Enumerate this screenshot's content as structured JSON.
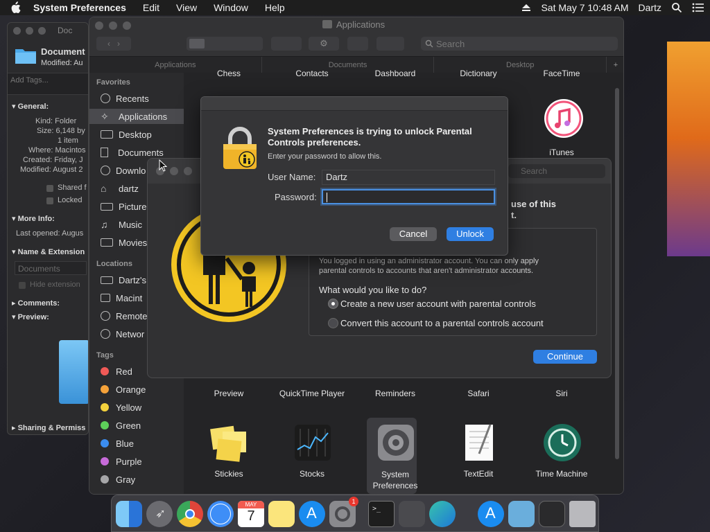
{
  "menubar": {
    "app_name": "System Preferences",
    "menus": [
      "Edit",
      "View",
      "Window",
      "Help"
    ],
    "datetime": "Sat May 7  10:48 AM",
    "user": "Dartz"
  },
  "info_window": {
    "title": "Doc",
    "name": "Document",
    "modified_short": "Modified: Au",
    "tags_placeholder": "Add Tags...",
    "general_header": "General:",
    "kind": "Kind: Folder",
    "size": "Size: 6,148 by",
    "items": "1 item",
    "where": "Where: Macintos",
    "created": "Created: Friday, J",
    "modified": "Modified: August 2",
    "shared": "Shared f",
    "locked": "Locked",
    "more_info": "More Info:",
    "last_opened": "Last opened: Augus",
    "name_ext": "Name & Extension",
    "name_value": "Documents",
    "hide_ext": "Hide extension",
    "comments": "Comments:",
    "preview": "Preview:",
    "sharing": "Sharing & Permiss"
  },
  "finder": {
    "title": "Applications",
    "search_placeholder": "Search",
    "tabs": [
      "Applications",
      "Documents",
      "Desktop"
    ],
    "sidebar": {
      "favorites_header": "Favorites",
      "favorites": [
        "Recents",
        "Applications",
        "Desktop",
        "Documents",
        "Downlo",
        "dartz",
        "Picture",
        "Music",
        "Movies"
      ],
      "locations_header": "Locations",
      "locations": [
        "Dartz's",
        "Macint",
        "Remote",
        "Networ"
      ],
      "tags_header": "Tags",
      "tags": [
        {
          "name": "Red",
          "color": "#f05a57"
        },
        {
          "name": "Orange",
          "color": "#f5a23a"
        },
        {
          "name": "Yellow",
          "color": "#f3d13d"
        },
        {
          "name": "Green",
          "color": "#5ed05a"
        },
        {
          "name": "Blue",
          "color": "#3b8df0"
        },
        {
          "name": "Purple",
          "color": "#c76bd9"
        },
        {
          "name": "Gray",
          "color": "#a6a6a8"
        }
      ]
    },
    "top_row_apps": [
      "Chess",
      "Contacts",
      "Dashboard",
      "Dictionary",
      "FaceTime"
    ],
    "itunes_label": "iTunes",
    "middle_row_apps": [
      "Preview",
      "QuickTime Player",
      "Reminders",
      "Safari",
      "Siri"
    ],
    "bottom_row_apps": [
      "Stickies",
      "Stocks",
      "System\nPreferences",
      "TextEdit",
      "Time Machine"
    ]
  },
  "parental": {
    "search_placeholder": "Search",
    "heading_partial": "use of this",
    "heading_partial2": "t.",
    "notice_line1": "You logged in using an administrator account. You can only apply",
    "notice_line2": "parental controls to accounts that aren't administrator accounts.",
    "question": "What would you like to do?",
    "option_create": "Create a new user account with parental controls",
    "option_convert": "Convert this account to a parental controls account",
    "continue_button": "Continue"
  },
  "unlock_dialog": {
    "title_line1": "System Preferences is trying to unlock Parental",
    "title_line2": "Controls preferences.",
    "subtitle": "Enter your password to allow this.",
    "username_label": "User Name:",
    "username_value": "Dartz",
    "password_label": "Password:",
    "password_value": "",
    "cancel_button": "Cancel",
    "unlock_button": "Unlock"
  },
  "dock": {
    "apps": [
      "Finder",
      "Launchpad",
      "Chrome",
      "Safari",
      "Calendar",
      "Notes",
      "App Store",
      "System Preferences",
      "Terminal",
      "Automator",
      "Edge",
      "App Store Folder",
      "Folder",
      "Screen",
      "Trash"
    ],
    "calendar_month": "MAY",
    "calendar_day": "7",
    "sysprefs_badge": "1"
  },
  "colors": {
    "accent_blue": "#2f7fe2",
    "lock_gold": "#f0b429",
    "parental_yellow": "#f3c623"
  }
}
